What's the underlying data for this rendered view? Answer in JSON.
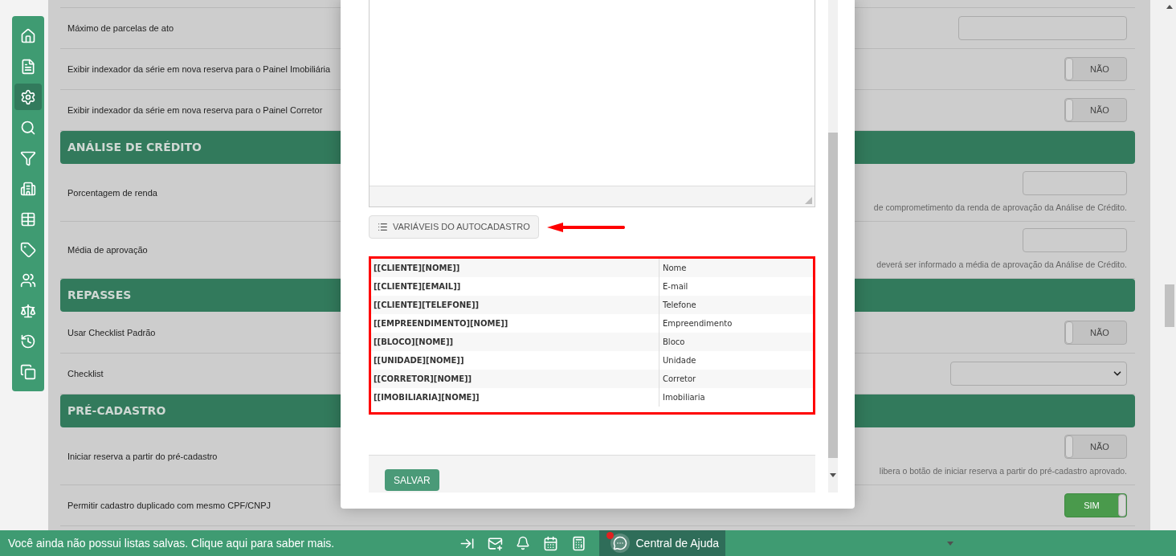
{
  "sidebar": {
    "items": [
      {
        "selected": false
      },
      {
        "selected": false
      },
      {
        "selected": true
      },
      {
        "selected": false
      },
      {
        "selected": false
      },
      {
        "selected": false
      },
      {
        "selected": false
      },
      {
        "selected": false
      },
      {
        "selected": false
      },
      {
        "selected": false
      },
      {
        "selected": false
      },
      {
        "selected": false
      }
    ]
  },
  "rows": [
    {
      "kind": "input",
      "label": "Máximo de parcelas de ato"
    },
    {
      "kind": "toggle",
      "label": "Exibir indexador da série em nova reserva para o Painel Imobiliária",
      "on": false,
      "value": "NÃO"
    },
    {
      "kind": "toggle",
      "label": "Exibir indexador da série em nova reserva para o Painel Corretor",
      "on": false,
      "value": "NÃO"
    },
    {
      "kind": "header",
      "label": "ANÁLISE DE CRÉDITO"
    },
    {
      "kind": "input",
      "label": "Porcentagem de renda",
      "hint": "de comprometimento da renda de aprovação da Análise de Crédito."
    },
    {
      "kind": "input",
      "label": "Média de aprovação",
      "hint": "deverá ser informado a média de aprovação da Análise de Crédito."
    },
    {
      "kind": "header",
      "label": "REPASSES"
    },
    {
      "kind": "toggle",
      "label": "Usar Checklist Padrão",
      "on": false,
      "value": "NÃO"
    },
    {
      "kind": "select",
      "label": "Checklist"
    },
    {
      "kind": "header",
      "label": "PRÉ-CADASTRO"
    },
    {
      "kind": "toggle",
      "label": "Iniciar reserva a partir do pré-cadastro",
      "on": false,
      "value": "NÃO",
      "hint": "libera o botão de iniciar reserva a partir do pré-cadastro aprovado."
    },
    {
      "kind": "toggle",
      "label": "Permitir cadastro duplicado com mesmo CPF/CNPJ",
      "on": true,
      "value": "SIM"
    }
  ],
  "modal": {
    "variables_button": "VARIÁVEIS DO AUTOCADASTRO",
    "variables": [
      {
        "variable": "[[CLIENTE][NOME]]",
        "description": "Nome"
      },
      {
        "variable": "[[CLIENTE][EMAIL]]",
        "description": "E-mail"
      },
      {
        "variable": "[[CLIENTE][TELEFONE]]",
        "description": "Telefone"
      },
      {
        "variable": "[[EMPREENDIMENTO][NOME]]",
        "description": "Empreendimento"
      },
      {
        "variable": "[[BLOCO][NOME]]",
        "description": "Bloco"
      },
      {
        "variable": "[[UNIDADE][NOME]]",
        "description": "Unidade"
      },
      {
        "variable": "[[CORRETOR][NOME]]",
        "description": "Corretor"
      },
      {
        "variable": "[[IMOBILIARIA][NOME]]",
        "description": "Imobiliaria"
      }
    ],
    "save_button": "SALVAR"
  },
  "footer": {
    "message": "Você ainda não possui listas salvas. Clique aqui para saber mais.",
    "help": "Central de Ajuda",
    "help_notification": true
  }
}
